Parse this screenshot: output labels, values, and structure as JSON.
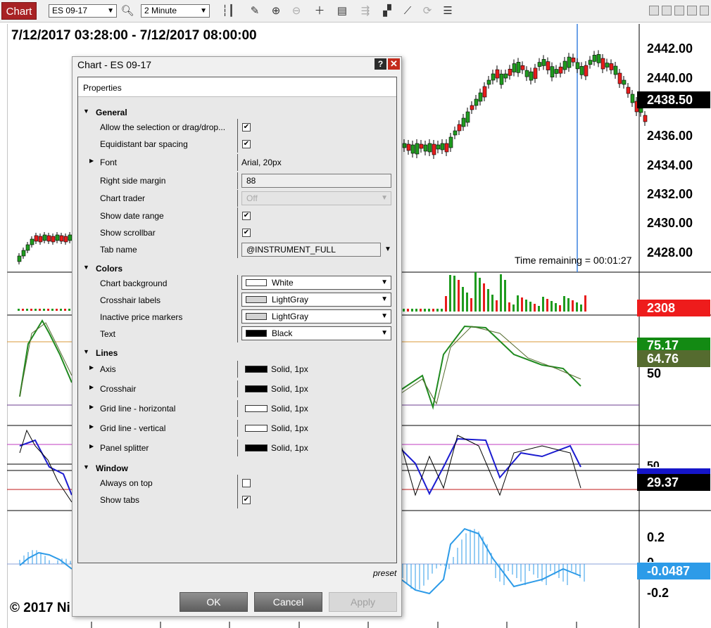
{
  "toolbar": {
    "tab_label": "Chart",
    "instrument": "ES 09-17",
    "interval": "2 Minute"
  },
  "chart": {
    "date_range": "7/12/2017 03:28:00 - 7/12/2017 08:00:00",
    "price_axis": [
      "2442.00",
      "2440.00",
      "2436.00",
      "2434.00",
      "2432.00",
      "2430.00",
      "2428.00"
    ],
    "price_tag": "2438.50",
    "time_remaining": "Time remaining = 00:01:27",
    "volume_tag": "2308",
    "stoch_tag_1": "75.17",
    "stoch_tag_2": "64.76",
    "stoch_axis_50": "50",
    "rsi_axis_50": "50",
    "rsi_tag": "29.37",
    "macd_axis": [
      "0.2",
      "0",
      "-0.2"
    ],
    "macd_tag": "-0.0487",
    "copyright": "© 2017 Ni",
    "colors": {
      "up_candle": "#1f9b1f",
      "down_candle": "#e81c1c",
      "price_tag": "#000000",
      "volume_tag": "#ee1c1c",
      "stoch_tag_1": "#138a13",
      "stoch_tag_2": "#556b2f",
      "rsi_tag": "#000000",
      "macd_tag": "#2d9be8",
      "cursor_line": "#3b82e0"
    }
  },
  "dialog": {
    "title": "Chart - ES 09-17",
    "help_label": "?",
    "close_label": "✕",
    "properties_header": "Properties",
    "general_label": "General",
    "general": {
      "allow_selection": "Allow the selection or drag/drop...",
      "equidistant": "Equidistant bar spacing",
      "font_label": "Font",
      "font_value": "Arial, 20px",
      "right_margin_label": "Right side margin",
      "right_margin_value": "88",
      "chart_trader_label": "Chart trader",
      "chart_trader_value": "Off",
      "show_date_range": "Show date range",
      "show_scrollbar": "Show scrollbar",
      "tab_name_label": "Tab name",
      "tab_name_value": "@INSTRUMENT_FULL"
    },
    "colors_label": "Colors",
    "colors": {
      "chart_bg_label": "Chart background",
      "chart_bg_value": "White",
      "crosshair_labels_label": "Crosshair labels",
      "crosshair_labels_value": "LightGray",
      "inactive_markers_label": "Inactive price markers",
      "inactive_markers_value": "LightGray",
      "text_label": "Text",
      "text_value": "Black"
    },
    "lines_label": "Lines",
    "lines": {
      "axis_label": "Axis",
      "axis_value": "Solid, 1px",
      "crosshair_label": "Crosshair",
      "crosshair_value": "Solid, 1px",
      "grid_h_label": "Grid line - horizontal",
      "grid_h_value": "Solid, 1px",
      "grid_v_label": "Grid line - vertical",
      "grid_v_value": "Solid, 1px",
      "splitter_label": "Panel splitter",
      "splitter_value": "Solid, 1px"
    },
    "window_label": "Window",
    "window": {
      "always_on_top": "Always on top",
      "show_tabs": "Show tabs"
    },
    "preset_label": "preset",
    "ok_label": "OK",
    "cancel_label": "Cancel",
    "apply_label": "Apply"
  }
}
